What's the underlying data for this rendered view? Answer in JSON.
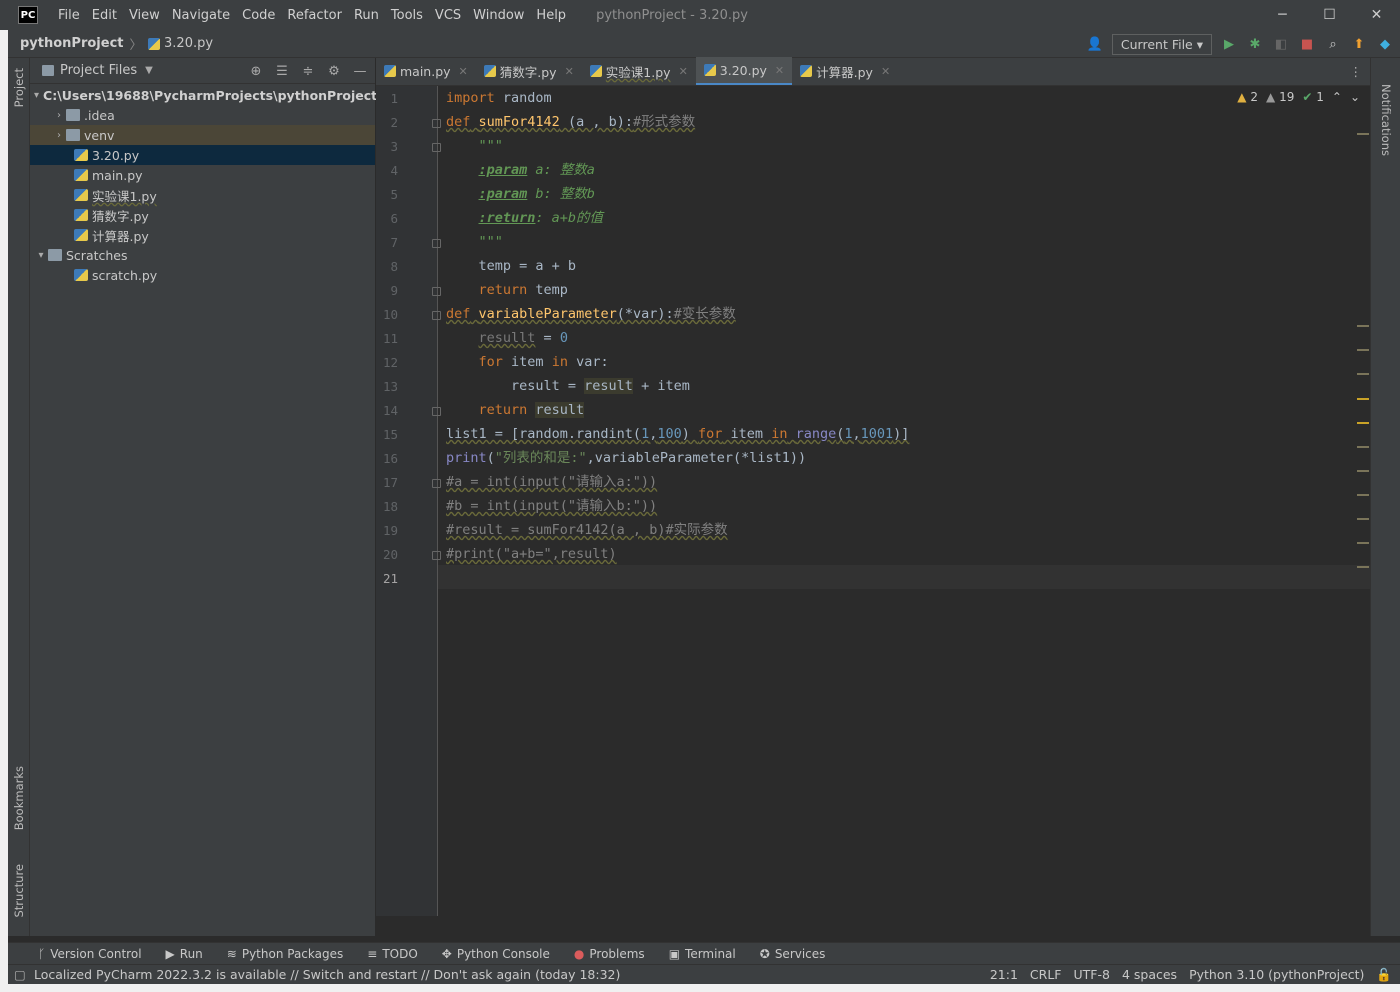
{
  "app": {
    "logo": "PC",
    "window_title": "pythonProject - 3.20.py"
  },
  "menu": [
    "File",
    "Edit",
    "View",
    "Navigate",
    "Code",
    "Refactor",
    "Run",
    "Tools",
    "VCS",
    "Window",
    "Help"
  ],
  "window_buttons": {
    "minimize": "─",
    "maximize": "☐",
    "close": "✕"
  },
  "navbar": {
    "project": "pythonProject",
    "file": "3.20.py",
    "run_config": "Current File ▾"
  },
  "project_panel": {
    "title": "Project Files",
    "tree": [
      {
        "label": "C:\\Users\\19688\\PycharmProjects\\pythonProject",
        "type": "folder",
        "arrow": "▾"
      },
      {
        "label": ".idea",
        "type": "folder",
        "arrow": "›"
      },
      {
        "label": "venv",
        "type": "folder",
        "arrow": "›"
      },
      {
        "label": "3.20.py",
        "type": "py",
        "arrow": ""
      },
      {
        "label": "main.py",
        "type": "py",
        "arrow": ""
      },
      {
        "label": "实验课1.py",
        "type": "py",
        "arrow": ""
      },
      {
        "label": "猜数字.py",
        "type": "py",
        "arrow": ""
      },
      {
        "label": "计算器.py",
        "type": "py",
        "arrow": ""
      },
      {
        "label": "Scratches",
        "type": "folder",
        "arrow": "▾"
      },
      {
        "label": "scratch.py",
        "type": "py",
        "arrow": ""
      }
    ]
  },
  "side_labels": {
    "project": "Project",
    "bookmarks": "Bookmarks",
    "structure": "Structure",
    "notifications": "Notifications"
  },
  "tabs": [
    "main.py",
    "猜数字.py",
    "实验课1.py",
    "3.20.py",
    "计算器.py"
  ],
  "active_tab": "3.20.py",
  "inspections": {
    "warnings": "2",
    "weak_warnings": "19",
    "ok": "1"
  },
  "line_numbers": [
    "1",
    "2",
    "3",
    "4",
    "5",
    "6",
    "7",
    "8",
    "9",
    "10",
    "11",
    "12",
    "13",
    "14",
    "15",
    "16",
    "17",
    "18",
    "19",
    "20",
    "21"
  ],
  "code": {
    "l1a": "import",
    "l1b": " random",
    "l2a": "def",
    "l2b": " ",
    "l2c": "sumFor4142",
    "l2d": " (a , b):",
    "l2e": "#形式参数",
    "l3": "    \"\"\"",
    "l4a": ":param",
    "l4b": " a: 整数a",
    "l5a": ":param",
    "l5b": " b: 整数b",
    "l6a": ":return",
    "l6b": ": a+b的值",
    "l7": "    \"\"\"",
    "l8": "    temp = a + b",
    "l9a": "    return",
    "l9b": " temp",
    "l10a": "def",
    "l10b": " ",
    "l10c": "variableParameter",
    "l10d": "(*var):",
    "l10e": "#变长参数",
    "l11a": "    ",
    "l11b": "resullt",
    "l11c": " = ",
    "l11d": "0",
    "l12a": "    for",
    "l12b": " item ",
    "l12c": "in",
    "l12d": " var:",
    "l13a": "        result = ",
    "l13b": "result",
    "l13c": " + item",
    "l14a": "    return",
    "l14b": " ",
    "l14c": "result",
    "l15a": "list1 = [random.randint(",
    "l15b": "1",
    "l15c": ",",
    "l15d": "100",
    "l15e": ") ",
    "l15f": "for",
    "l15g": " item ",
    "l15h": "in",
    "l15i": " ",
    "l15j": "range",
    "l15k": "(",
    "l15l": "1",
    "l15m": ",",
    "l15n": "1001",
    "l15o": ")]",
    "l16a": "print",
    "l16b": "(",
    "l16c": "\"列表的和是:\"",
    "l16d": ",variableParameter(*list1))",
    "l17": "#a = int(input(\"请输入a:\"))",
    "l18": "#b = int(input(\"请输入b:\"))",
    "l19": "#result = sumFor4142(a , b)#实际参数",
    "l20": "#print(\"a+b=\",result)"
  },
  "bottom_tools": [
    "Version Control",
    "Run",
    "Python Packages",
    "TODO",
    "Python Console",
    "Problems",
    "Terminal",
    "Services"
  ],
  "status": {
    "message": "Localized PyCharm 2022.3.2 is available // Switch and restart // Don't ask again (today 18:32)",
    "position": "21:1",
    "line_sep": "CRLF",
    "encoding": "UTF-8",
    "indent": "4 spaces",
    "interpreter": "Python 3.10 (pythonProject)"
  },
  "colors": {
    "accent": "#4a88c7",
    "keyword": "#cc7832",
    "function": "#ffc66d",
    "string": "#6a8759",
    "number": "#6897bb",
    "comment": "#808080"
  }
}
